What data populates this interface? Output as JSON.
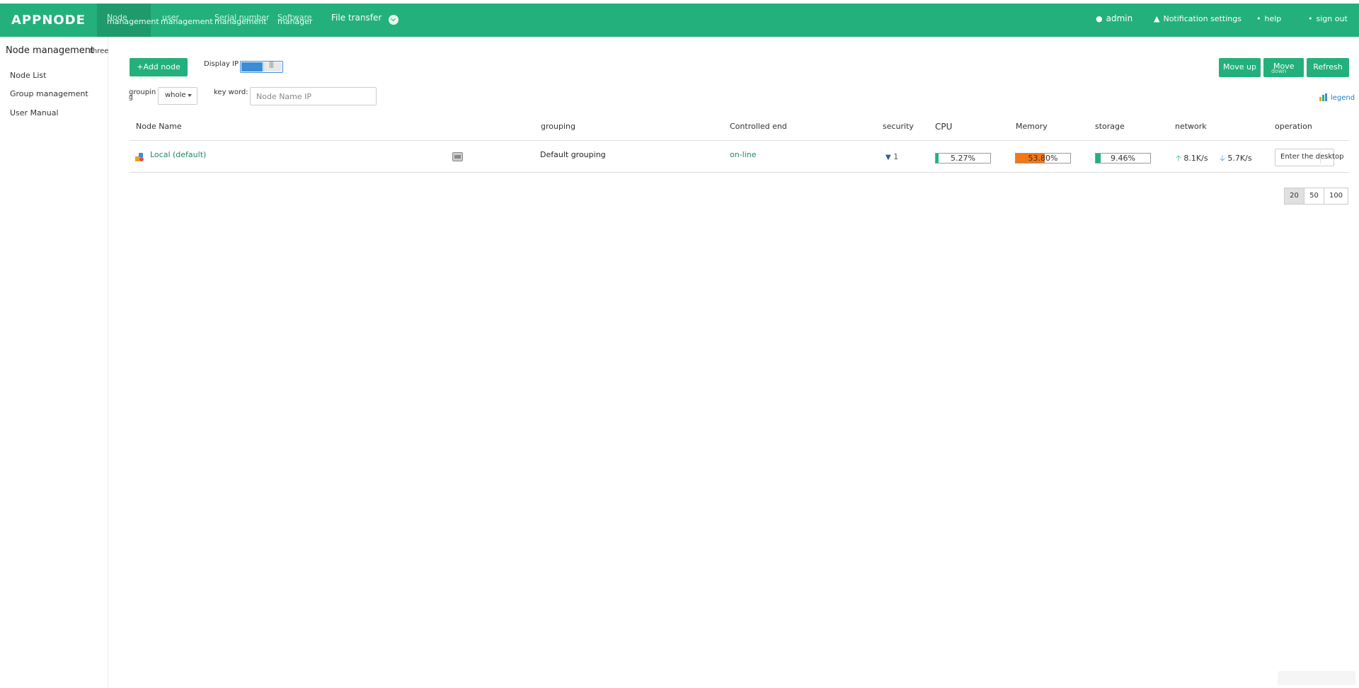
{
  "app": {
    "logo": "APPNODE"
  },
  "topnav": {
    "items": [
      {
        "l1": "Node",
        "l2": "management",
        "active": true
      },
      {
        "l1": "user",
        "l2": "management"
      },
      {
        "l1": "Serial number",
        "l2": "management"
      },
      {
        "l1": "Software",
        "l2": "manager"
      }
    ],
    "file_transfer": "File transfer",
    "right": {
      "admin": "admin",
      "notifications": "Notification settings",
      "help": "help",
      "sign_out": "sign out"
    }
  },
  "sidebar": {
    "title": "Node management",
    "title_extra": "three",
    "items": [
      "Node List",
      "Group management",
      "User Manual"
    ]
  },
  "toolbar": {
    "add_node": "+Add node",
    "display_ip_label": "Display IP",
    "display_ip_on": true,
    "group_label": "groupin",
    "group_label_2": "g",
    "group_value": "whole",
    "keyword_label": "key word:",
    "keyword_placeholder": "Node Name IP",
    "move_up": "Move up",
    "move_down_1": "Move",
    "move_down_2": "down",
    "refresh": "Refresh",
    "legend": "legend"
  },
  "table": {
    "headers": [
      "Node Name",
      "grouping",
      "Controlled end",
      "security",
      "CPU",
      "Memory",
      "storage",
      "network",
      "operation"
    ],
    "rows": [
      {
        "name": "Local (default)",
        "grouping": "Default grouping",
        "controlled_end": "on-line",
        "security": "1",
        "cpu_text": "5.27%",
        "cpu_pct": 5.27,
        "memory_text": "53.80%",
        "memory_pct": 53.8,
        "storage_text": "9.46%",
        "storage_pct": 9.46,
        "net_up": "8.1K/s",
        "net_down": "5.7K/s",
        "operation": "Enter the desktop"
      }
    ]
  },
  "pager": {
    "sizes": [
      "20",
      "50",
      "100"
    ],
    "active": "20"
  },
  "colors": {
    "brand": "#23b07d",
    "memory_fill": "#f07818",
    "cpu_fill": "#23b07d",
    "accent_blue": "#3b8dd6"
  }
}
